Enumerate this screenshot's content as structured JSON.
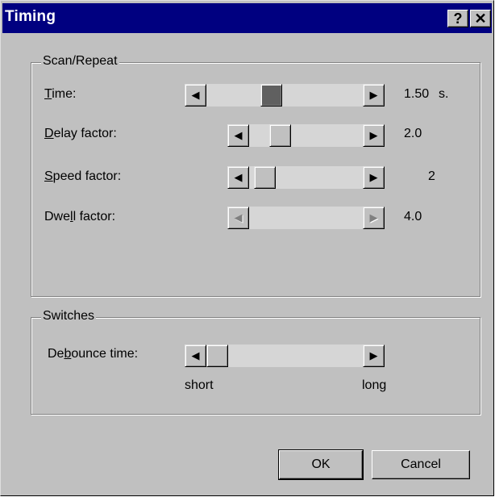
{
  "dialog": {
    "title": "Timing",
    "help_glyph": "?",
    "close_glyph": "✕"
  },
  "scan_repeat": {
    "legend": "Scan/Repeat",
    "time": {
      "label_pre": "",
      "label_ul": "T",
      "label_post": "ime:",
      "value": "1.50",
      "unit": "s.",
      "position": 0.4,
      "enabled": true
    },
    "delay": {
      "label_pre": "",
      "label_ul": "D",
      "label_post": "elay factor:",
      "value": "2.0",
      "position": 0.22,
      "enabled": true
    },
    "speed": {
      "label_pre": "",
      "label_ul": "S",
      "label_post": "peed factor:",
      "value": "2",
      "position": 0.05,
      "enabled": true
    },
    "dwell": {
      "label_pre": "Dwe",
      "label_ul": "l",
      "label_post": "l factor:",
      "value": "4.0",
      "position": null,
      "enabled": false
    }
  },
  "switches": {
    "legend": "Switches",
    "debounce": {
      "label_pre": "De",
      "label_ul": "b",
      "label_post": "ounce time:",
      "position": 0.0,
      "enabled": true
    },
    "short_label": "short",
    "long_label": "long"
  },
  "buttons": {
    "ok": "OK",
    "cancel": "Cancel"
  },
  "icons": {
    "left_arrow": "arrow-left-icon",
    "right_arrow": "arrow-right-icon"
  }
}
